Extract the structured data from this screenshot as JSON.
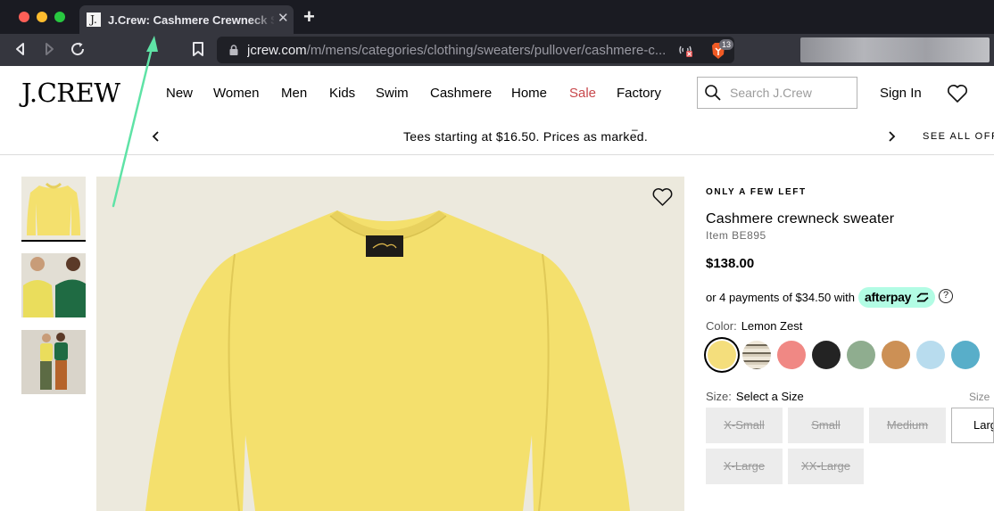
{
  "browser": {
    "tab": {
      "favicon_letter": "J.",
      "title": "J.Crew: Cashmere Crewneck Sweater",
      "close_glyph": "✕"
    },
    "new_tab_glyph": "+",
    "address": {
      "host": "jcrew.com",
      "path": "/m/mens/categories/clothing/sweaters/pullover/cashmere-c..."
    },
    "brave_shield_count": "13"
  },
  "site": {
    "logo": "J.CREW",
    "nav": [
      "New",
      "Women",
      "Men",
      "Kids",
      "Swim",
      "Cashmere",
      "Home",
      "Sale",
      "Factory"
    ],
    "search_placeholder": "Search J.Crew",
    "sign_in": "Sign In"
  },
  "promo": {
    "text": "Tees starting at $16.50. Prices as marked.",
    "dash": "–",
    "see_all": "SEE ALL OFFERS"
  },
  "product": {
    "badge": "ONLY A FEW LEFT",
    "title": "Cashmere crewneck sweater",
    "item": "Item BE895",
    "price": "$138.00",
    "afterpay_text": "or 4 payments of $34.50 with",
    "afterpay_brand": "afterpay",
    "afterpay_help": "?",
    "color_label": "Color:",
    "color_value": "Lemon Zest",
    "swatches": [
      {
        "name": "Lemon Zest",
        "color": "#f4de7c",
        "selected": true
      },
      {
        "name": "Ivory stripe",
        "color": "#d8cfbd",
        "selected": false
      },
      {
        "name": "Coral",
        "color": "#f08884",
        "selected": false
      },
      {
        "name": "Black",
        "color": "#232323",
        "selected": false
      },
      {
        "name": "Sage",
        "color": "#8fad8f",
        "selected": false
      },
      {
        "name": "Camel",
        "color": "#cc9055",
        "selected": false
      },
      {
        "name": "Light blue",
        "color": "#b8dcee",
        "selected": false
      },
      {
        "name": "Aqua",
        "color": "#58aec9",
        "selected": false
      }
    ],
    "size_label": "Size:",
    "size_value": "Select a Size",
    "size_guide": "Size",
    "sizes": [
      {
        "label": "X-Small",
        "available": false
      },
      {
        "label": "Small",
        "available": false
      },
      {
        "label": "Medium",
        "available": false
      },
      {
        "label": "Large",
        "available": true
      },
      {
        "label": "X-Large",
        "available": false
      },
      {
        "label": "XX-Large",
        "available": false
      }
    ]
  },
  "colors": {
    "annotation_arrow": "#5fe3a6",
    "sale": "#c8484c",
    "afterpay_mint": "#b2fce4",
    "sweater_yellow": "#f4e06d"
  }
}
